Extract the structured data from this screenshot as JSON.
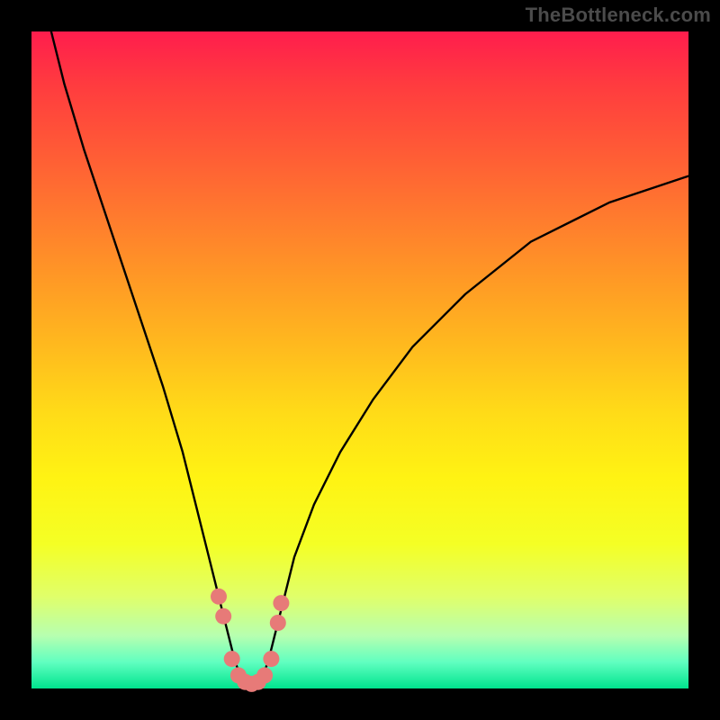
{
  "watermark": "TheBottleneck.com",
  "chart_data": {
    "type": "line",
    "title": "",
    "xlabel": "",
    "ylabel": "",
    "xlim": [
      0,
      100
    ],
    "ylim": [
      0,
      100
    ],
    "series": [
      {
        "name": "bottleneck-curve",
        "x": [
          3,
          5,
          8,
          12,
          16,
          20,
          23,
          25,
          27,
          28.5,
          30,
          31,
          32,
          33,
          34,
          35,
          36,
          37,
          38.5,
          40,
          43,
          47,
          52,
          58,
          66,
          76,
          88,
          100
        ],
        "y": [
          100,
          92,
          82,
          70,
          58,
          46,
          36,
          28,
          20,
          14,
          8,
          4,
          1.5,
          0.5,
          0.5,
          1.5,
          4,
          8,
          14,
          20,
          28,
          36,
          44,
          52,
          60,
          68,
          74,
          78
        ]
      }
    ],
    "markers": {
      "name": "highlight-dots",
      "color": "#e77a78",
      "points": [
        {
          "x": 28.5,
          "y": 14
        },
        {
          "x": 29.2,
          "y": 11
        },
        {
          "x": 30.5,
          "y": 4.5
        },
        {
          "x": 31.5,
          "y": 2
        },
        {
          "x": 32.5,
          "y": 1
        },
        {
          "x": 33.5,
          "y": 0.7
        },
        {
          "x": 34.5,
          "y": 1
        },
        {
          "x": 35.5,
          "y": 2
        },
        {
          "x": 36.5,
          "y": 4.5
        },
        {
          "x": 37.5,
          "y": 10
        },
        {
          "x": 38.0,
          "y": 13
        }
      ]
    },
    "gradient_stops": [
      {
        "pos": 0.0,
        "color": "#ff1d4d"
      },
      {
        "pos": 0.5,
        "color": "#ffdb18"
      },
      {
        "pos": 0.8,
        "color": "#f4ff25"
      },
      {
        "pos": 1.0,
        "color": "#00e38e"
      }
    ]
  }
}
